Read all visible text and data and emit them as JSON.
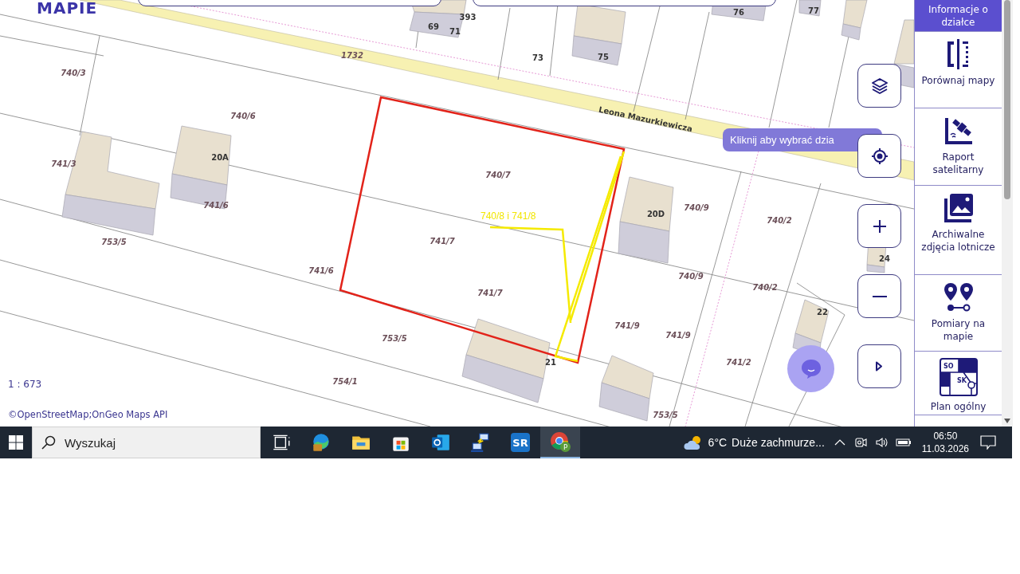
{
  "app_title_fragment": "MAPIE",
  "map": {
    "street_name": "Leona Mazurkiewicza",
    "parcel_labels": [
      "740/3",
      "1732",
      "740/6",
      "741/3",
      "741/6",
      "753/5",
      "740/7",
      "741/7",
      "741/6",
      "741/7",
      "753/5",
      "754/1",
      "740/9",
      "740/2",
      "740/9",
      "740/2",
      "741/9",
      "741/9",
      "741/2",
      "753/5"
    ],
    "house_numbers": [
      "393",
      "69",
      "71",
      "73",
      "75",
      "76",
      "77",
      "20A",
      "20D",
      "24",
      "22",
      "21"
    ],
    "annotation": "740/8 i 741/8",
    "scale": "1 : 673",
    "attribution": "©OpenStreetMap;OnGeo Maps API"
  },
  "tooltip": "Kliknij aby wybrać dzia",
  "map_controls": [
    {
      "kind": "layers"
    },
    {
      "kind": "locate"
    },
    {
      "kind": "zoom_in"
    },
    {
      "kind": "zoom_out"
    },
    {
      "kind": "play"
    }
  ],
  "sidebar": {
    "items": [
      {
        "kind": "info",
        "label": "Informacje o działce",
        "selected": true
      },
      {
        "kind": "compare",
        "label": "Porównaj mapy",
        "selected": false
      },
      {
        "kind": "satellite",
        "label": "Raport satelitarny",
        "selected": false
      },
      {
        "kind": "archive",
        "label": "Archiwalne zdjęcia lotnicze",
        "selected": false
      },
      {
        "kind": "measure",
        "label": "Pomiary na mapie",
        "selected": false
      },
      {
        "kind": "plan",
        "label": "Plan ogólny",
        "selected": false,
        "icon_text": [
          "SO",
          "SK"
        ]
      }
    ]
  },
  "taskbar": {
    "search_placeholder": "Wyszukaj",
    "apps": [
      {
        "kind": "task_view",
        "selected": false
      },
      {
        "kind": "edge",
        "selected": false
      },
      {
        "kind": "explorer",
        "selected": false
      },
      {
        "kind": "store",
        "selected": false
      },
      {
        "kind": "outlook",
        "selected": false
      },
      {
        "kind": "network",
        "selected": false
      },
      {
        "kind": "sr",
        "selected": false,
        "icon_text": "SR"
      },
      {
        "kind": "chrome",
        "selected": true,
        "badge": "P"
      }
    ],
    "weather": {
      "temperature": "6°C",
      "condition": "Duże zachmurze..."
    },
    "clock": {
      "time": "06:50",
      "date": "11.03.2026"
    }
  }
}
